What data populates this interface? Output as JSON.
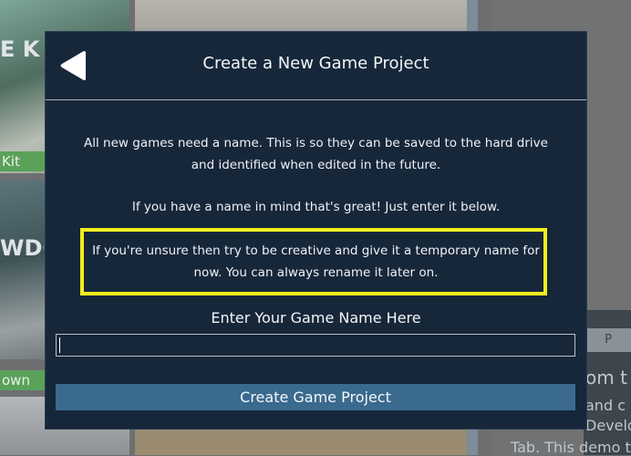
{
  "background": {
    "left_card_top_label": "E K",
    "left_kit_tag": "Kit",
    "left_mid_label": "WDG",
    "left_down_tag": "own",
    "right_pill": "P",
    "right_lines": [
      "om t",
      "and c",
      "Develo",
      "Tab. This demo t"
    ]
  },
  "modal": {
    "title": "Create a New Game Project",
    "back_icon": "back-arrow-icon",
    "paragraph_1": "All new games need a name. This is so they can be saved to the hard drive and identified when edited in the future.",
    "paragraph_2": "If you have a name in mind that's great! Just enter it below.",
    "paragraph_3": "If you're unsure then try to be creative and give it a temporary name for now. You can always rename it later on.",
    "highlight_color": "#f1ee1f",
    "field_label": "Enter Your Game Name Here",
    "name_input": {
      "value": "",
      "placeholder": ""
    },
    "create_button_label": "Create Game Project"
  },
  "colors": {
    "modal_background": "#17273a",
    "button_background": "#3a6a8e",
    "tag_green": "#5aa15a"
  }
}
